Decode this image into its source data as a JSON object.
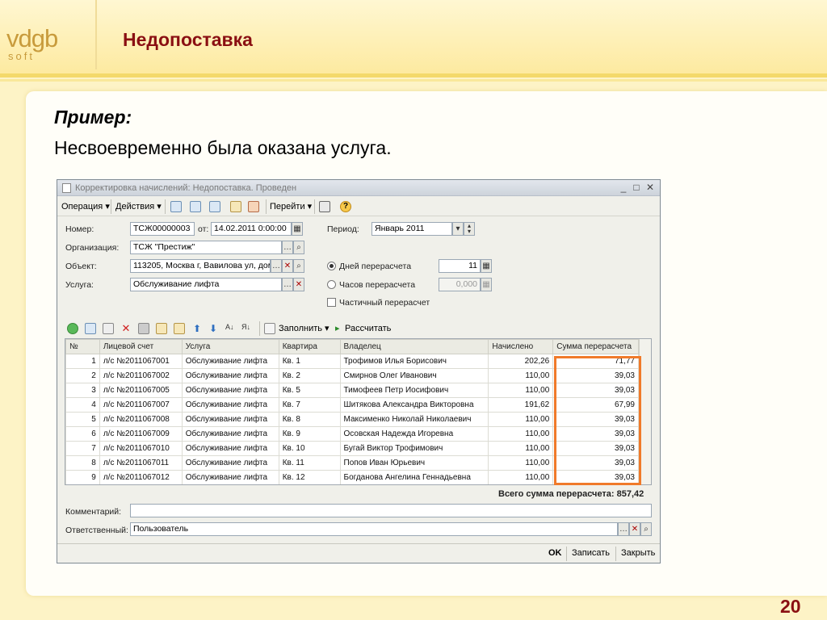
{
  "logo": {
    "line1": "vdgb",
    "line2": "soft"
  },
  "slide": {
    "title": "Недопоставка",
    "example_label": "Пример:",
    "example_text": "Несвоевременно была оказана услуга.",
    "page_number": "20"
  },
  "window": {
    "title": "Корректировка начислений: Недопоставка. Проведен",
    "toolbar": {
      "operation": "Операция ▾",
      "actions": "Действия ▾",
      "goto": "Перейти ▾"
    },
    "form": {
      "number_label": "Номер:",
      "number_value": "ТСЖ00000003",
      "from_label": "от:",
      "date_value": "14.02.2011 0:00:00",
      "period_label": "Период:",
      "period_value": "Январь 2011",
      "org_label": "Организация:",
      "org_value": "ТСЖ \"Престиж\"",
      "object_label": "Объект:",
      "object_value": "113205, Москва г, Вавилова ул, дом",
      "service_label": "Услуга:",
      "service_value": "Обслуживание лифта",
      "days_label": "Дней перерасчета",
      "days_value": "11",
      "hours_label": "Часов перерасчета",
      "hours_value": "0,000",
      "partial_label": "Частичный перерасчет",
      "comment_label": "Комментарий:",
      "comment_value": "",
      "responsible_label": "Ответственный:",
      "responsible_value": "Пользователь"
    },
    "grid_toolbar": {
      "fill": "Заполнить ▾",
      "calculate": "Рассчитать"
    },
    "columns": [
      "№",
      "Лицевой счет",
      "Услуга",
      "Квартира",
      "Владелец",
      "Начислено",
      "Сумма перерасчета"
    ],
    "rows": [
      {
        "n": "1",
        "account": "л/с №2011067001",
        "service": "Обслуживание лифта",
        "flat": "Кв. 1",
        "owner": "Трофимов Илья Борисович",
        "charged": "202,26",
        "recalc": "71,77"
      },
      {
        "n": "2",
        "account": "л/с №2011067002",
        "service": "Обслуживание лифта",
        "flat": "Кв. 2",
        "owner": "Смирнов Олег Иванович",
        "charged": "110,00",
        "recalc": "39,03"
      },
      {
        "n": "3",
        "account": "л/с №2011067005",
        "service": "Обслуживание лифта",
        "flat": "Кв. 5",
        "owner": "Тимофеев Петр Иосифович",
        "charged": "110,00",
        "recalc": "39,03"
      },
      {
        "n": "4",
        "account": "л/с №2011067007",
        "service": "Обслуживание лифта",
        "flat": "Кв. 7",
        "owner": "Шитякова Александра Викторовна",
        "charged": "191,62",
        "recalc": "67,99"
      },
      {
        "n": "5",
        "account": "л/с №2011067008",
        "service": "Обслуживание лифта",
        "flat": "Кв. 8",
        "owner": "Максименко Николай Николаевич",
        "charged": "110,00",
        "recalc": "39,03"
      },
      {
        "n": "6",
        "account": "л/с №2011067009",
        "service": "Обслуживание лифта",
        "flat": "Кв. 9",
        "owner": "Осовская Надежда Игоревна",
        "charged": "110,00",
        "recalc": "39,03"
      },
      {
        "n": "7",
        "account": "л/с №2011067010",
        "service": "Обслуживание лифта",
        "flat": "Кв. 10",
        "owner": "Бугай Виктор Трофимович",
        "charged": "110,00",
        "recalc": "39,03"
      },
      {
        "n": "8",
        "account": "л/с №2011067011",
        "service": "Обслуживание лифта",
        "flat": "Кв. 11",
        "owner": "Попов Иван Юрьевич",
        "charged": "110,00",
        "recalc": "39,03"
      },
      {
        "n": "9",
        "account": "л/с №2011067012",
        "service": "Обслуживание лифта",
        "flat": "Кв. 12",
        "owner": "Богданова Ангелина Геннадьевна",
        "charged": "110,00",
        "recalc": "39,03"
      }
    ],
    "total": "Всего сумма перерасчета: 857,42",
    "buttons": {
      "ok": "OK",
      "save": "Записать",
      "close": "Закрыть"
    }
  },
  "colors": {
    "title": "#8a0f12",
    "highlight": "#f07a2a",
    "logo": "#c89b3c"
  }
}
